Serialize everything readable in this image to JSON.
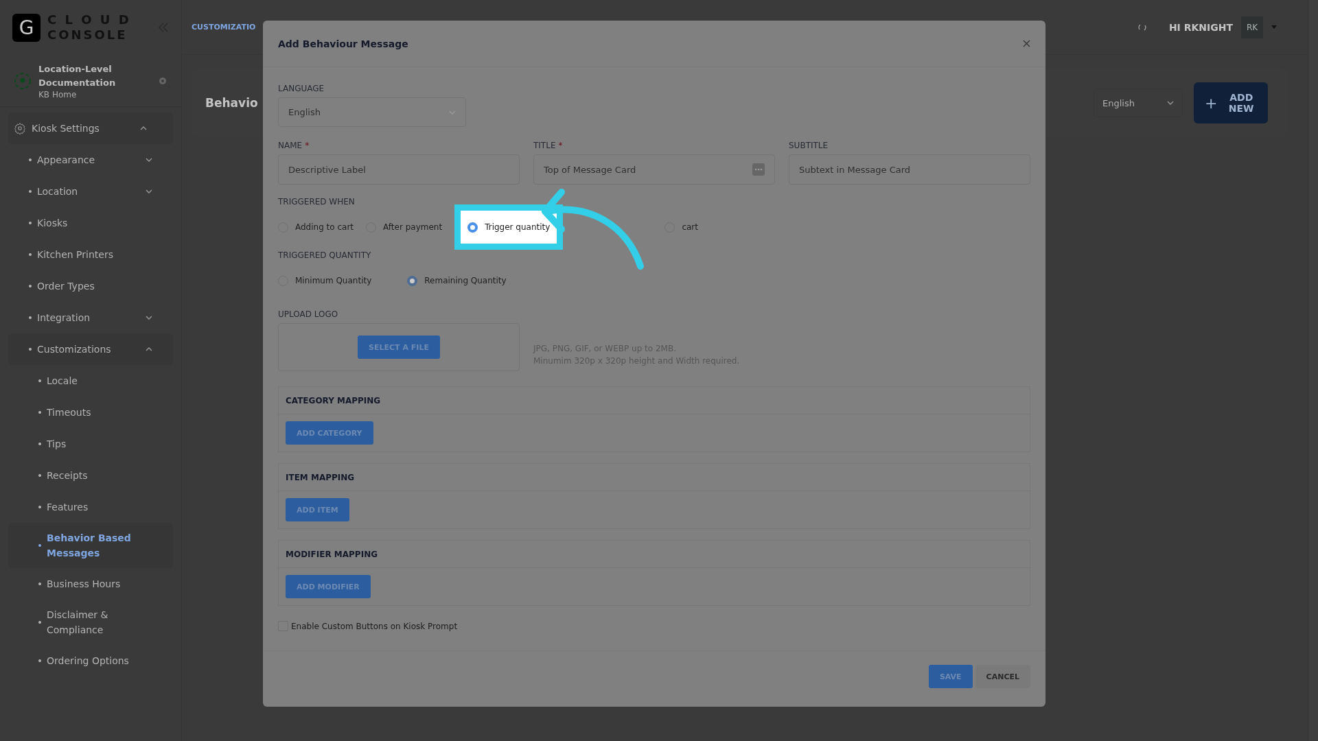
{
  "brand": {
    "logo_letter": "G",
    "line1": "C L O U D",
    "line2": "CONSOLE"
  },
  "location": {
    "title": "Location-Level Documentation",
    "subtitle": "KB Home"
  },
  "sidebar": {
    "items": [
      {
        "label": "Kiosk Settings",
        "expanded": true,
        "selected": false,
        "children": [
          {
            "label": "Appearance",
            "expanded": false,
            "selected": false
          },
          {
            "label": "Location",
            "expanded": false,
            "selected": false
          },
          {
            "label": "Kiosks",
            "selected": false
          },
          {
            "label": "Kitchen Printers",
            "selected": false
          },
          {
            "label": "Order Types",
            "selected": false
          },
          {
            "label": "Integration",
            "expanded": false,
            "selected": false
          },
          {
            "label": "Customizations",
            "expanded": true,
            "selected": false,
            "children": [
              {
                "label": "Locale",
                "selected": false
              },
              {
                "label": "Timeouts",
                "selected": false
              },
              {
                "label": "Tips",
                "selected": false
              },
              {
                "label": "Receipts",
                "selected": false
              },
              {
                "label": "Features",
                "selected": false
              },
              {
                "label": "Behavior Based Messages",
                "selected": true
              },
              {
                "label": "Business Hours",
                "selected": false
              },
              {
                "label": "Disclaimer & Compliance",
                "selected": false
              },
              {
                "label": "Ordering Options",
                "selected": false
              }
            ]
          }
        ]
      }
    ]
  },
  "header": {
    "breadcrumb": "CUSTOMIZATIO",
    "greeting": "HI RKNIGHT",
    "avatar": "RK"
  },
  "page": {
    "title": "Behavio",
    "language": "English",
    "add_icon": "+",
    "add_button": "ADD NEW"
  },
  "modal": {
    "title": "Add Behaviour Message",
    "language": {
      "label": "LANGUAGE",
      "value": "English"
    },
    "fields": [
      {
        "label": "NAME",
        "required_mark": "*",
        "placeholder": "Descriptive Label"
      },
      {
        "label": "TITLE",
        "required_mark": "*",
        "placeholder": "Top of Message Card",
        "kind": "with_button"
      },
      {
        "label": "SUBTITLE",
        "placeholder": "Subtext in Message Card",
        "kind": "plain"
      }
    ],
    "triggered_when": {
      "label": "TRIGGERED WHEN",
      "options": [
        {
          "label": "Adding to cart",
          "selected": false,
          "highlighted": false
        },
        {
          "label": "After payment",
          "selected": false,
          "highlighted": false
        },
        {
          "label": "Trigger quantity",
          "selected": true,
          "highlighted": true
        },
        {
          "label": "cart",
          "selected": false,
          "highlighted": false
        }
      ]
    },
    "triggered_quantity": {
      "label": "TRIGGERED QUANTITY",
      "options": [
        {
          "label": "Minimum Quantity",
          "selected": false
        },
        {
          "label": "Remaining Quantity",
          "selected": true
        }
      ]
    },
    "upload": {
      "label": "UPLOAD LOGO",
      "button": "SELECT A FILE",
      "hints": [
        "JPG, PNG, GIF, or WEBP up to 2MB.",
        "Minumim 320p x 320p height and Width required."
      ]
    },
    "mappings": [
      {
        "title": "CATEGORY MAPPING",
        "button": "ADD CATEGORY"
      },
      {
        "title": "ITEM MAPPING",
        "button": "ADD ITEM"
      },
      {
        "title": "MODIFIER MAPPING",
        "button": "ADD MODIFIER"
      }
    ],
    "custom_buttons": {
      "label": "Enable Custom Buttons on Kiosk Prompt",
      "checked": false
    },
    "actions": {
      "save": "SAVE",
      "cancel": "CANCEL"
    }
  }
}
